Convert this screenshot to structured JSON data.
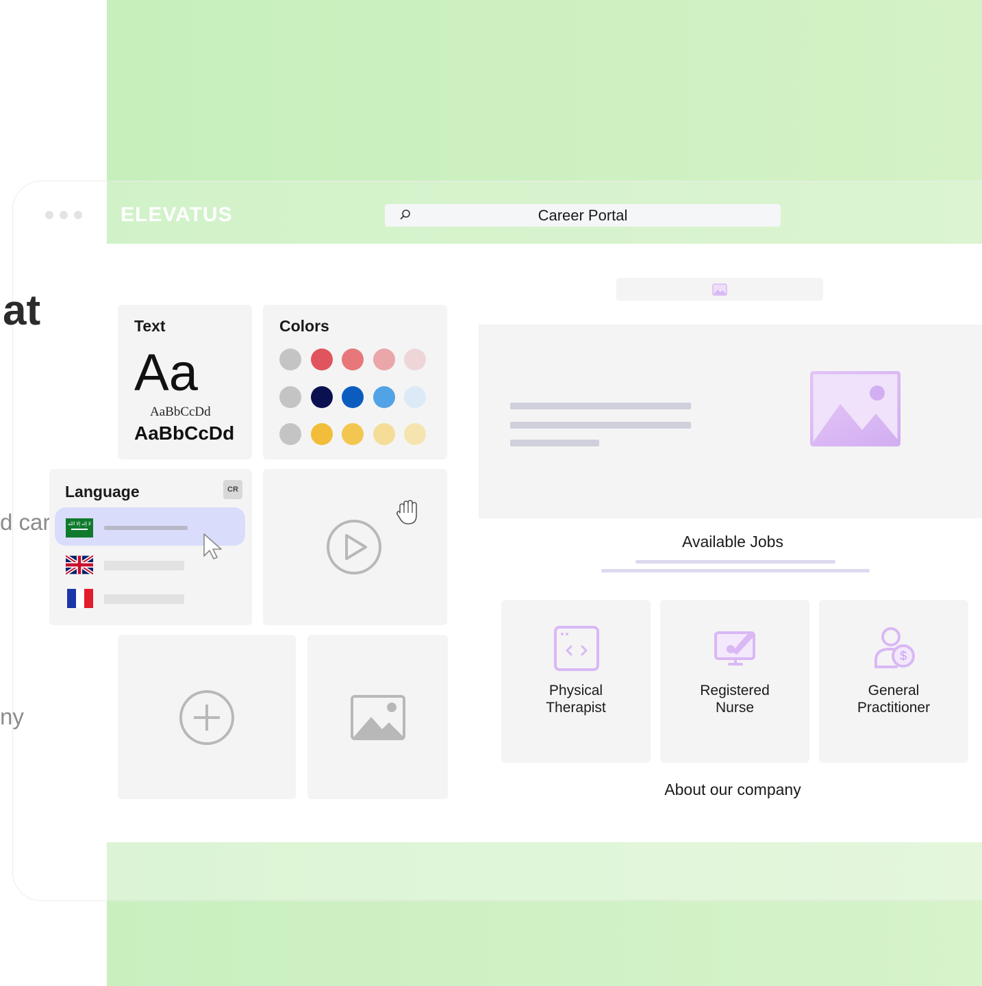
{
  "browser": {
    "logo_text": "ELEVATUS",
    "search_placeholder": "Career Portal"
  },
  "background_text": {
    "heading_fragment": "at",
    "line1_fragment": "d car",
    "line2_fragment": "ny"
  },
  "text_card": {
    "title": "Text",
    "big_sample": "Aa",
    "serif_sample": "AaBbCcDd",
    "bold_sample": "AaBbCcDd"
  },
  "colors_card": {
    "title": "Colors",
    "rows": [
      [
        "#c4c4c4",
        "#e0545e",
        "#e7777a",
        "#eba6aa",
        "#eed6d8"
      ],
      [
        "#c4c4c4",
        "#0b1150",
        "#0c5cc0",
        "#52a3e6",
        "#dceaf7"
      ],
      [
        "#c4c4c4",
        "#f1bd3a",
        "#f3c651",
        "#f5dd97",
        "#f6e4b0"
      ]
    ]
  },
  "language_card": {
    "title": "Language",
    "badge": "CR",
    "flag_saudi_text": "لا إله إلا الله",
    "languages": [
      {
        "flag": "saudi-flag-icon",
        "selected": true
      },
      {
        "flag": "uk-flag-icon",
        "selected": false
      },
      {
        "flag": "france-flag-icon",
        "selected": false
      }
    ]
  },
  "main": {
    "available_jobs_title": "Available Jobs",
    "about_title": "About our company",
    "jobs": [
      {
        "label": "Physical\nTherapist",
        "icon": "code-window-icon"
      },
      {
        "label": "Registered\nNurse",
        "icon": "monitor-edit-icon"
      },
      {
        "label": "General\nPractitioner",
        "icon": "person-dollar-icon"
      }
    ]
  },
  "accent_colors": {
    "green": "#c6efbc",
    "purple": "#d9b8f5",
    "selection": "#d9ddfb"
  }
}
